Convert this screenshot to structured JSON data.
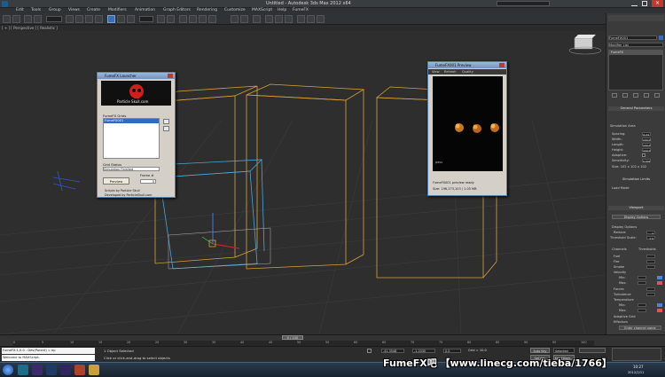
{
  "titlebar": {
    "title": "Untitled - Autodesk 3ds Max 2012 x64",
    "search_placeholder": "Type a keyword or phrase"
  },
  "menu": [
    "Edit",
    "Tools",
    "Group",
    "Views",
    "Create",
    "Modifiers",
    "Animation",
    "Graph Editors",
    "Rendering",
    "Customize",
    "MAXScript",
    "Help",
    "FumeFX"
  ],
  "viewport_label": "[ + ] [ Perspective ] [ Realistic ]",
  "fume_window": {
    "title": "FumeFX Launcher",
    "banner_text": "Particle Skull.com",
    "grids_label": "FumeFX Grids",
    "grid_item": "FumeFX001",
    "status_label": "Grid Status",
    "status_value": "Simulation Finished",
    "preview_button": "Preview",
    "frame_label": "Frame #",
    "frame_value": "0",
    "credit_line1": "Scripts by Particle Skull",
    "credit_line2": "Developed by ParticleSkull.com"
  },
  "preview_window": {
    "title": "FumeFX001 Preview",
    "menu": [
      "View",
      "Refresh",
      "Quality"
    ],
    "canvas_label": "pass",
    "info_line1": "FumeFX001 preview ready",
    "info_line2": "Size: 196,173,103 / 1.05 MB"
  },
  "command_panel": {
    "object_name": "FumeFX001",
    "modifier_list": "Modifier List",
    "stack_item": "FumeFX",
    "general": "General Parameters",
    "sim_area": "Simulation Area",
    "params": [
      {
        "label": "Spacing:",
        "value": "0.24"
      },
      {
        "label": "Width:",
        "value": "100.0"
      },
      {
        "label": "Length:",
        "value": "100.0"
      },
      {
        "label": "Height:",
        "value": "100.0"
      },
      {
        "label": "Adaptive:",
        "value": ""
      },
      {
        "label": "Sensitivity:",
        "value": "0.001"
      }
    ],
    "size_line": "Size: 102 x 102 x 102",
    "sim_limits": "Simulation Limits",
    "load_mode": "Load Mode",
    "viewport": "Viewport",
    "display_dropdown": "Display Options",
    "display_options": "Display Options",
    "reduce_label": "Reduce:",
    "reduce_value": "1",
    "threshold_label": "Threshold Scale:",
    "threshold_value": "1.0",
    "channels": "Channels",
    "thresholds": "Thresholds",
    "channel_list": [
      "Fuel",
      "Fire",
      "Smoke",
      "Velocity",
      "Forces",
      "Turbulence",
      "Temperature"
    ],
    "min_label": "Min:",
    "max_label": "Max:",
    "effectors": "Effectors",
    "adaptive_grid": "Adaptive Grid",
    "enter_channel": "Enter channel name"
  },
  "timeline": {
    "frame_readout": "0 / 100",
    "ticks": [
      "0",
      "5",
      "10",
      "15",
      "20",
      "25",
      "30",
      "35",
      "40",
      "45",
      "50",
      "55",
      "60",
      "65",
      "70",
      "75",
      "80",
      "85",
      "90",
      "95",
      "100"
    ]
  },
  "status": {
    "listener": "FumeFX:1.0.0 - Dev(Parent) = ep",
    "listener2": "Welcome to MAXScript.",
    "selected": "1 Object Selected",
    "prompt": "Click or click-and-drag to select objects",
    "coord_x": "-41.3548",
    "coord_y": "-1.2035",
    "coord_z": "0.0",
    "grid": "Grid = 10.0",
    "autokey": "Auto Key",
    "selected_mode": "Selected",
    "setkey": "Set Key",
    "keyfilters": "Key Filters..."
  },
  "taskbar": {
    "time": "10:27",
    "date": "2012/2/11"
  },
  "watermark": "FumeFX吧 【www.linecg.com/tieba/1766】",
  "colors": {
    "grid_yellow": "#d9a23a",
    "grid_blue": "#4aa6d8",
    "accent_red": "#cc2222"
  }
}
